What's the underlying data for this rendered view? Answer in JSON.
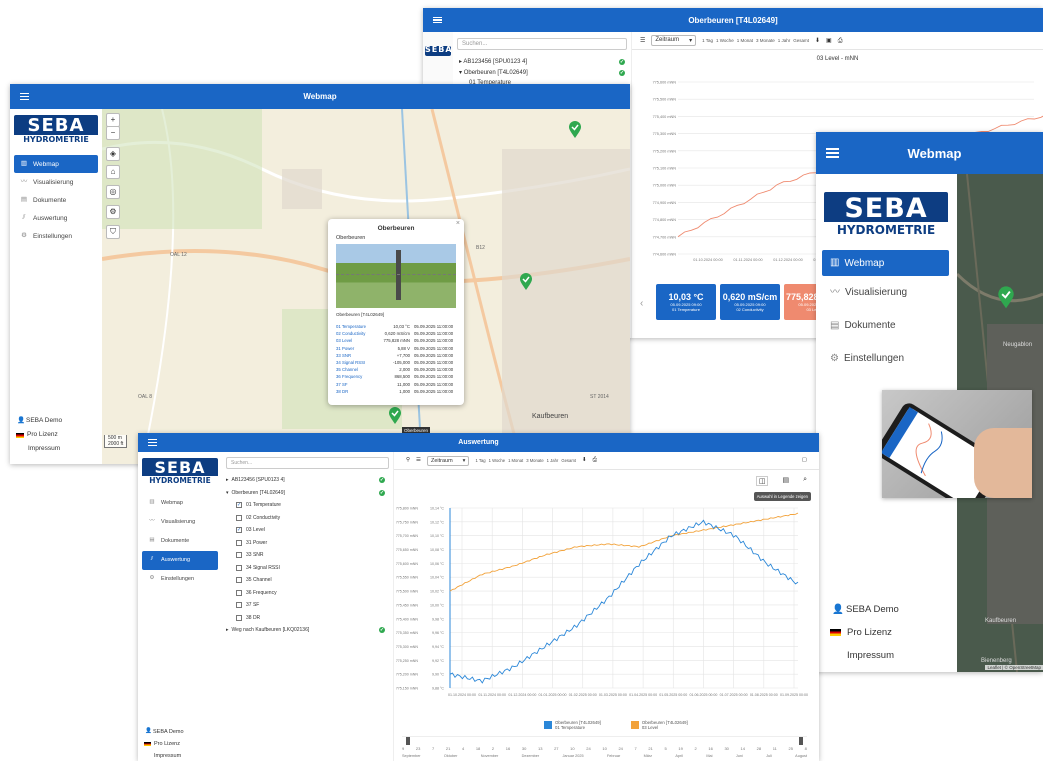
{
  "win1": {
    "title": "Oberbeuren [T4L02649]",
    "search": "Suchen...",
    "tree": [
      {
        "label": "AB123456 [SPU0123 4]"
      },
      {
        "label": "Oberbeuren [T4L02649]"
      },
      {
        "label": "01 Temperature"
      }
    ],
    "zeitraum": "Zeitraum",
    "ranges": [
      "1 Tag",
      "1 Woche",
      "1 Monat",
      "3 Monate",
      "1 Jahr",
      "Gesamt"
    ],
    "chart_title": "03 Level - mNN",
    "y_ticks": [
      "775,600 mNN",
      "775,500 mNN",
      "775,400 mNN",
      "775,300 mNN",
      "775,200 mNN",
      "775,100 mNN",
      "775,000 mNN",
      "774,900 mNN",
      "774,800 mNN",
      "774,700 mNN",
      "774,600 mNN"
    ],
    "x_ticks": [
      "01.10.2024 00:00",
      "01.11.2024 00:00",
      "01.12.2024 00:00",
      "01.01.2025 00:00"
    ],
    "values": [
      {
        "val": "10,03 °C",
        "date": "05.09.2025 09:00",
        "name": "01 Temperature",
        "color": "#1a66c5"
      },
      {
        "val": "0,620 mS/cm",
        "date": "05.09.2025 09:00",
        "name": "02 Conductivity",
        "color": "#1a66c5"
      },
      {
        "val": "775,828 mNN",
        "date": "05.09.2025 09:00",
        "name": "03 Level",
        "color": "#ef8a6f"
      }
    ]
  },
  "win2": {
    "title": "Webmap",
    "nav": [
      {
        "label": "Webmap",
        "icon": "map-icon"
      },
      {
        "label": "Visualisierung",
        "icon": "chart-line-icon"
      },
      {
        "label": "Dokumente",
        "icon": "documents-icon"
      },
      {
        "label": "Auswertung",
        "icon": "analytics-icon"
      },
      {
        "label": "Einstellungen",
        "icon": "gear-icon"
      }
    ],
    "user": "SEBA Demo",
    "license": "Pro Lizenz",
    "impressum": "Impressum",
    "popup": {
      "title": "Oberbeuren",
      "subtitle": "Oberbeuren",
      "caption": "Oberbeuren [T4L02649]",
      "rows": [
        {
          "name": "01 Temperature",
          "value": "10,03 °C",
          "time": "05.09.2025 11:00:00"
        },
        {
          "name": "02 Conductivity",
          "value": "0,620 mS/cm",
          "time": "05.09.2025 11:00:00"
        },
        {
          "name": "03 Level",
          "value": "775,828 mNN",
          "time": "05.09.2025 11:00:00"
        },
        {
          "name": "31 Power",
          "value": "5,88 V",
          "time": "05.09.2025 11:00:00"
        },
        {
          "name": "33 SNR",
          "value": "+7,700",
          "time": "05.09.2025 11:00:00"
        },
        {
          "name": "34 Signal RSSI",
          "value": "-105,000",
          "time": "05.09.2025 11:00:00"
        },
        {
          "name": "35 Channel",
          "value": "2,000",
          "time": "05.09.2025 11:00:00"
        },
        {
          "name": "36 Frequency",
          "value": "868,500",
          "time": "05.09.2025 11:00:00"
        },
        {
          "name": "37 SF",
          "value": "11,000",
          "time": "05.09.2025 11:00:00"
        },
        {
          "name": "38 DR",
          "value": "1,000",
          "time": "05.09.2025 11:00:00"
        }
      ],
      "pin_label": "Oberbeuren"
    },
    "map_labels": [
      "Kaufbeuren",
      "OAL 12",
      "B12",
      "ST 2014",
      "OAL 8"
    ],
    "scale": [
      "500 m",
      "2000 ft"
    ]
  },
  "win3": {
    "title": "Webmap",
    "nav": [
      {
        "label": "Webmap"
      },
      {
        "label": "Visualisierung"
      },
      {
        "label": "Dokumente"
      },
      {
        "label": "Einstellungen"
      }
    ],
    "user": "SEBA Demo",
    "license": "Pro Lizenz",
    "impressum": "Impressum",
    "map_labels": [
      "Neugablon",
      "Kaufbeuren",
      "Bienenberg"
    ],
    "attribution": "Leaflet | © OpenStreetMap"
  },
  "win4": {
    "title": "Auswertung",
    "search": "Suchen...",
    "nav": [
      {
        "label": "Webmap"
      },
      {
        "label": "Visualisierung"
      },
      {
        "label": "Dokumente"
      },
      {
        "label": "Auswertung"
      },
      {
        "label": "Einstellungen"
      }
    ],
    "tree": [
      {
        "label": "AB123456 [SPU0123 4]",
        "level": 0
      },
      {
        "label": "Oberbeuren [T4L02649]",
        "level": 0
      },
      {
        "label": "01 Temperature",
        "level": 1,
        "checked": true
      },
      {
        "label": "02 Conductivity",
        "level": 1,
        "checked": false
      },
      {
        "label": "03 Level",
        "level": 1,
        "checked": true
      },
      {
        "label": "31 Power",
        "level": 1,
        "checked": false
      },
      {
        "label": "33 SNR",
        "level": 1,
        "checked": false
      },
      {
        "label": "34 Signal RSSI",
        "level": 1,
        "checked": false
      },
      {
        "label": "35 Channel",
        "level": 1,
        "checked": false
      },
      {
        "label": "36 Frequency",
        "level": 1,
        "checked": false
      },
      {
        "label": "37 SF",
        "level": 1,
        "checked": false
      },
      {
        "label": "38 DR",
        "level": 1,
        "checked": false
      },
      {
        "label": "Weg nach Kaufbeuren [LKQ02136]",
        "level": 0
      }
    ],
    "user": "SEBA Demo",
    "license": "Pro Lizenz",
    "impressum": "Impressum",
    "zeitraum": "Zeitraum",
    "ranges": [
      "1 Tag",
      "1 Woche",
      "1 Monat",
      "3 Monate",
      "1 Jahr",
      "Gesamt"
    ],
    "tooltip": "Auswahl in Legende zeigen",
    "legend": [
      {
        "name": "Oberbeuren [T4L02649]",
        "sub": "01 Temperature",
        "color": "#2b87d8"
      },
      {
        "name": "Oberbeuren [T4L02649]",
        "sub": "03 Level",
        "color": "#f2a23a"
      }
    ],
    "left_ticks": [
      "775,800 mNN",
      "775,750 mNN",
      "775,700 mNN",
      "775,650 mNN",
      "775,600 mNN",
      "775,550 mNN",
      "775,500 mNN",
      "775,450 mNN",
      "775,400 mNN",
      "775,350 mNN",
      "775,300 mNN",
      "775,250 mNN",
      "775,200 mNN",
      "775,150 mNN"
    ],
    "right_ticks": [
      "10,14 °C",
      "10,12 °C",
      "10,10 °C",
      "10,08 °C",
      "10,06 °C",
      "10,04 °C",
      "10,02 °C",
      "10,00 °C",
      "9,98 °C",
      "9,96 °C",
      "9,94 °C",
      "9,92 °C",
      "9,90 °C",
      "9,88 °C"
    ],
    "x_ticks": [
      "01.10.2024 00:00",
      "01.11.2024 00:00",
      "01.12.2024 00:00",
      "01.01.2025 00:00",
      "01.02.2025 00:00",
      "01.03.2025 00:00",
      "01.04.2025 00:00",
      "01.05.2025 00:00",
      "01.06.2025 00:00",
      "01.07.2025 00:00",
      "01.08.2025 00:00",
      "01.09.2025 00:00"
    ],
    "nav_nums": [
      "9",
      "23",
      "7",
      "21",
      "4",
      "18",
      "2",
      "16",
      "30",
      "13",
      "27",
      "10",
      "24",
      "10",
      "24",
      "7",
      "21",
      "5",
      "19",
      "2",
      "16",
      "30",
      "14",
      "28",
      "11",
      "25",
      "8"
    ],
    "nav_months": [
      "September",
      "Oktober",
      "November",
      "Dezember",
      "Januar 2025",
      "Februar",
      "März",
      "April",
      "Mai",
      "Juni",
      "Juli",
      "August"
    ]
  },
  "chart_data": [
    {
      "type": "line",
      "title": "03 Level - mNN",
      "x": [
        "01.10.2024",
        "01.11.2024",
        "01.12.2024",
        "01.01.2025",
        "01.02.2025"
      ],
      "series": [
        {
          "name": "03 Level",
          "values": [
            774.7,
            775.0,
            775.2,
            775.3,
            775.45
          ]
        }
      ],
      "ylim": [
        774.6,
        775.6
      ]
    },
    {
      "type": "line",
      "x": [
        "01.10.2024",
        "01.11.2024",
        "01.12.2024",
        "01.01.2025",
        "01.02.2025",
        "01.03.2025",
        "01.04.2025",
        "01.05.2025",
        "01.06.2025",
        "01.07.2025",
        "01.08.2025",
        "01.09.2025"
      ],
      "series": [
        {
          "name": "01 Temperature",
          "axis": "right",
          "values": [
            9.9,
            9.89,
            9.91,
            9.94,
            9.97,
            10.01,
            10.06,
            10.1,
            10.12,
            10.1,
            10.06,
            10.03
          ]
        },
        {
          "name": "03 Level",
          "axis": "left",
          "values": [
            775.5,
            775.56,
            775.59,
            775.63,
            775.66,
            775.67,
            775.66,
            775.7,
            775.72,
            775.74,
            775.76,
            775.78
          ]
        }
      ],
      "ylim_left": [
        775.15,
        775.8
      ],
      "ylim_right": [
        9.88,
        10.14
      ]
    }
  ]
}
